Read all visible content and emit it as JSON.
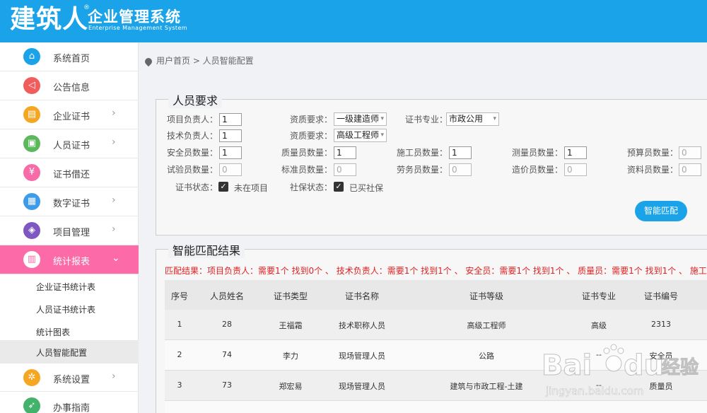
{
  "header": {
    "logo_text": "建筑人",
    "logo_reg": "®",
    "title": "企业管理系统",
    "subtitle": "Enterprise Management System"
  },
  "sidebar": {
    "items": [
      {
        "label": "系统首页",
        "icon": "home-icon",
        "color": "#1aa3e8",
        "glyph": "⌂",
        "arrow": false
      },
      {
        "label": "公告信息",
        "icon": "megaphone-icon",
        "color": "#f25c5c",
        "glyph": "◁",
        "arrow": false
      },
      {
        "label": "企业证书",
        "icon": "certificate-icon",
        "color": "#f5a623",
        "glyph": "▤",
        "arrow": true
      },
      {
        "label": "人员证书",
        "icon": "id-card-icon",
        "color": "#5cb85c",
        "glyph": "▣",
        "arrow": true
      },
      {
        "label": "证书借还",
        "icon": "yen-icon",
        "color": "#f76ba8",
        "glyph": "¥",
        "arrow": false
      },
      {
        "label": "数字证书",
        "icon": "document-icon",
        "color": "#3d9be9",
        "glyph": "▦",
        "arrow": true
      },
      {
        "label": "项目管理",
        "icon": "layers-icon",
        "color": "#7e57c2",
        "glyph": "◈",
        "arrow": true
      },
      {
        "label": "统计报表",
        "icon": "chart-icon",
        "color": "#ffffff",
        "glyph": "▥",
        "arrow": true,
        "active": true
      },
      {
        "label": "系统设置",
        "icon": "gear-icon",
        "color": "#f5a623",
        "glyph": "✲",
        "arrow": true
      },
      {
        "label": "办事指南",
        "icon": "compass-icon",
        "color": "#43b36b",
        "glyph": "➶",
        "arrow": false
      }
    ],
    "sub_items": [
      "企业证书统计表",
      "人员证书统计表",
      "统计图表",
      "人员智能配置"
    ]
  },
  "breadcrumb": "用户首页 > 人员智能配置",
  "requirements": {
    "title": "人员要求",
    "project_manager_label": "项目负责人：",
    "project_manager_value": "1",
    "qualification_label": "资质要求：",
    "qualification_1": "一级建造师",
    "major_label": "证书专业：",
    "major_value": "市政公用",
    "tech_manager_label": "技术负责人：",
    "tech_manager_value": "1",
    "qualification_2": "高级工程师",
    "counts": [
      {
        "label": "安全员数量：",
        "value": "1"
      },
      {
        "label": "质量员数量：",
        "value": "1"
      },
      {
        "label": "施工员数量：",
        "value": "1"
      },
      {
        "label": "测量员数量：",
        "value": "1"
      },
      {
        "label": "预算员数量：",
        "value": "0"
      },
      {
        "label": "试验员数量：",
        "value": "0"
      },
      {
        "label": "标准员数量：",
        "value": "0"
      },
      {
        "label": "劳务员数量：",
        "value": "0"
      },
      {
        "label": "造价员数量：",
        "value": "0"
      },
      {
        "label": "资料员数量：",
        "value": "0"
      }
    ],
    "cert_status_label": "证书状态：",
    "cert_status_value": "未在项目",
    "insurance_label": "社保状态：",
    "insurance_value": "已买社保",
    "match_button": "智能匹配"
  },
  "result": {
    "title": "智能匹配结果",
    "summary": "匹配结果：项目负责人：需要1个 找到0个 、 技术负责人：需要1个 找到1个 、 安全员：需要1个 找到1个 、 质量员：需要1个 找到1个 、 施工员：需",
    "columns": [
      "序号",
      "人员姓名",
      "证书类型",
      "证书名称",
      "证书等级",
      "证书专业",
      "证书编号"
    ],
    "rows": [
      [
        "1",
        "28",
        "王福霜",
        "技术职称人员",
        "高级工程师",
        "高级",
        "2313"
      ],
      [
        "2",
        "74",
        "李力",
        "现场管理人员",
        "公路",
        "--",
        "安全员"
      ],
      [
        "3",
        "73",
        "郑宏易",
        "现场管理人员",
        "建筑与市政工程-土建",
        "--",
        "质量员"
      ]
    ]
  },
  "watermark": {
    "brand": "Bai",
    "brand2": "du",
    "suffix": "经验",
    "url": "jingyan.baidu.com"
  }
}
